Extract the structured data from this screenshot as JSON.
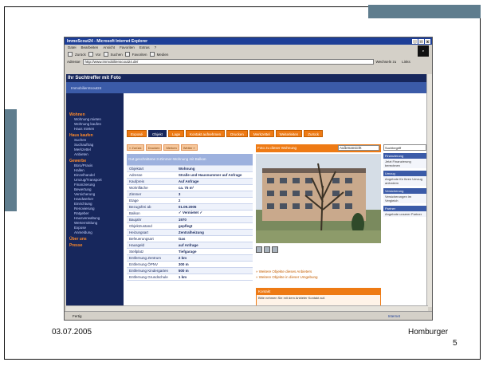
{
  "slide": {
    "footer_date": "03.07.2005",
    "footer_author": "Homburger",
    "page_number": "5"
  },
  "browser": {
    "title": "ImmoScout24 - Microsoft Internet Explorer",
    "window_controls": [
      "_",
      "□",
      "x"
    ],
    "menu": [
      "Datei",
      "Bearbeiten",
      "Ansicht",
      "Favoriten",
      "Extras",
      "?"
    ],
    "toolbar": [
      "Zurück",
      "Vor",
      "Suchen",
      "Favoriten",
      "Medien"
    ],
    "address_label": "Adresse",
    "address_value": "http://www.immobilienscout24.de/",
    "address_go": "Wechseln zu",
    "links_label": "Links",
    "status_left": "Fertig",
    "status_zone": "Internet"
  },
  "page": {
    "site_title": "Ihr Suchtreffer mit Foto",
    "subheader": "ImmobilienScout24",
    "nav": [
      {
        "label": "Wohnen",
        "type": "head"
      },
      {
        "label": "Wohnung mieten",
        "type": "sub"
      },
      {
        "label": "Wohnung kaufen",
        "type": "sub"
      },
      {
        "label": "Haus mieten",
        "type": "sub"
      },
      {
        "label": "Haus kaufen",
        "type": "head"
      },
      {
        "label": "Suchen",
        "type": "sub"
      },
      {
        "label": "Suchauftrag",
        "type": "sub"
      },
      {
        "label": "Merkzettel",
        "type": "sub"
      },
      {
        "label": "Anbieten",
        "type": "sub"
      },
      {
        "label": "Gewerbe",
        "type": "head"
      },
      {
        "label": "Büro/Praxis",
        "type": "sub"
      },
      {
        "label": "Hallen",
        "type": "sub"
      },
      {
        "label": "Einzelhandel",
        "type": "sub"
      },
      {
        "label": "Umzug/Transport",
        "type": "sub"
      },
      {
        "label": "Finanzierung",
        "type": "sub"
      },
      {
        "label": "Bewertung",
        "type": "sub"
      },
      {
        "label": "Versicherung",
        "type": "sub"
      },
      {
        "label": "Handwerker",
        "type": "sub"
      },
      {
        "label": "Einrichtung",
        "type": "sub"
      },
      {
        "label": "Renovierung",
        "type": "sub"
      },
      {
        "label": "Ratgeber",
        "type": "sub"
      },
      {
        "label": "Hausverwaltung",
        "type": "sub"
      },
      {
        "label": "Wertermittlung",
        "type": "sub"
      },
      {
        "label": "Expose",
        "type": "sub"
      },
      {
        "label": "Anmeldung",
        "type": "sub"
      },
      {
        "label": "Über uns",
        "type": "head"
      },
      {
        "label": "Presse",
        "type": "head"
      }
    ],
    "tabs": [
      {
        "label": "Exposé",
        "active": false
      },
      {
        "label": "Objekt",
        "active": true
      },
      {
        "label": "Lage",
        "active": false
      },
      {
        "label": "Kontakt aufnehmen",
        "active": false
      },
      {
        "label": "Drucken",
        "active": false
      },
      {
        "label": "Merkzettel",
        "active": false
      },
      {
        "label": "Weiterleiten",
        "active": false
      },
      {
        "label": "Zurück",
        "active": false
      }
    ],
    "toolrow": [
      "« Zurück",
      "Drucken",
      "Merken",
      "Weiter »"
    ],
    "detail_caption": "Gut geschnittene 3-Zimmer-Wohnung mit Balkon",
    "details": [
      {
        "label": "Objektart",
        "value": "Wohnung"
      },
      {
        "label": "Adresse",
        "value": "Straße und Hausnummer auf Anfrage"
      },
      {
        "label": "Kaufpreis",
        "value": "Auf Anfrage"
      },
      {
        "label": "Wohnfläche",
        "value": "ca. 75 m²"
      },
      {
        "label": "Zimmer",
        "value": "3"
      },
      {
        "label": "Etage",
        "value": "2"
      },
      {
        "label": "Bezugsfrei ab",
        "value": "01.09.2005"
      },
      {
        "label": "Balkon",
        "value": "✓ Vermietet ✓"
      },
      {
        "label": "Baujahr",
        "value": "1970"
      },
      {
        "label": "Objektzustand",
        "value": "gepflegt"
      },
      {
        "label": "Heizungsart",
        "value": "Zentralheizung"
      },
      {
        "label": "Befeuerungsart",
        "value": "Gas"
      },
      {
        "label": "Hausgeld",
        "value": "auf Anfrage"
      },
      {
        "label": "Stellplatz",
        "value": "Tiefgarage"
      },
      {
        "label": "Entfernung Zentrum",
        "value": "2 km"
      },
      {
        "label": "Entfernung ÖPNV",
        "value": "300 m"
      },
      {
        "label": "Entfernung Kindergarten",
        "value": "500 m"
      },
      {
        "label": "Entfernung Grundschule",
        "value": "1 km"
      }
    ],
    "photo_header": "Foto zu dieser Wohnung",
    "photo_select": "Außenansicht",
    "photo_links": [
      "» Weitere Objekte dieses Anbieters",
      "» Weitere Objekte in dieser Umgebung"
    ],
    "contact_head": "Kontakt",
    "contact_text": "Bitte nehmen Sie mit dem Anbieter Kontakt auf.",
    "right_col": {
      "search_placeholder": "Suchbegriff",
      "boxes": [
        {
          "head": "Finanzierung",
          "body": "Jetzt Finanzierung berechnen"
        },
        {
          "head": "Umzug",
          "body": "Angebote für Ihren Umzug anfordern"
        },
        {
          "head": "Versicherung",
          "body": "Versicherungen im Vergleich"
        },
        {
          "head": "Partner",
          "body": "Angebote unserer Partner"
        }
      ]
    }
  },
  "colors": {
    "slide_accent": "#5f7d8e",
    "site_navy": "#17275c",
    "site_orange": "#ee7a14",
    "ie_titlebar": "#1d3e97"
  }
}
